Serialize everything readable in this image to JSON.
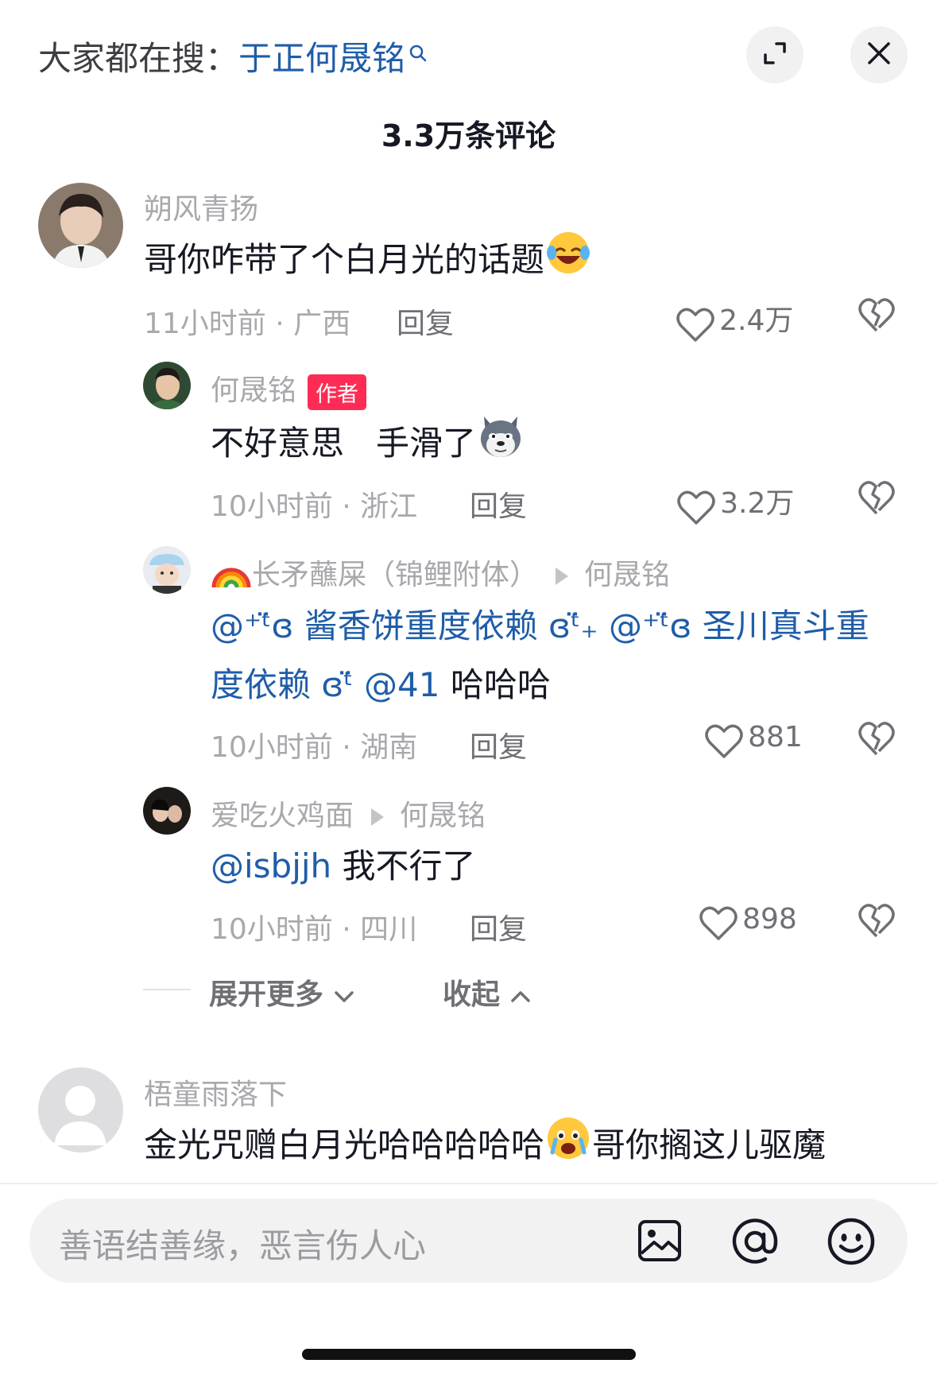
{
  "header": {
    "search_prefix": "大家都在搜：",
    "search_keyword": "于正何晟铭",
    "comment_count": "3.3万条评论"
  },
  "comments": [
    {
      "username": "朔风青扬",
      "text": "哥你咋带了个白月光的话题",
      "time_location": "11小时前 · 广西",
      "reply_label": "回复",
      "likes": "2.4万"
    },
    {
      "username": "梧童雨落下",
      "text": "金光咒赠白月光哈哈哈哈哈",
      "text_suffix": "哥你搁这儿驱魔"
    }
  ],
  "replies": [
    {
      "username": "何晟铭",
      "badge": "作者",
      "text": "不好意思   手滑了",
      "time_location": "10小时前 · 浙江",
      "reply_label": "回复",
      "likes": "3.2万"
    },
    {
      "username": "长矛蘸屎（锦鲤附体）",
      "reply_to": "何晟铭",
      "mention1": "@⁺ᵗ̈ɞ 酱香饼重度依赖 ɞᵗ̈₊",
      "mention2": "@⁺ᵗ̈ɞ 圣川真斗重",
      "mention2_cont": "度依赖 ɞᵗ̈",
      "mention3": "@41",
      "text_tail": "哈哈哈",
      "time_location": "10小时前 · 湖南",
      "reply_label": "回复",
      "likes": "881"
    },
    {
      "username": "爱吃火鸡面",
      "reply_to": "何晟铭",
      "mention": "@isbjjh",
      "text": "我不行了",
      "time_location": "10小时前 · 四川",
      "reply_label": "回复",
      "likes": "898"
    }
  ],
  "thread_controls": {
    "expand_more": "展开更多",
    "collapse": "收起"
  },
  "input": {
    "placeholder": "善语结善缘，恶言伤人心"
  },
  "icons": [
    "search-mini-icon",
    "expand-icon",
    "close-icon",
    "heart-icon",
    "broken-heart-icon",
    "image-icon",
    "at-icon",
    "emoji-icon",
    "chevron-down-icon",
    "chevron-up-icon"
  ],
  "colors": {
    "accent_red": "#fe2c55",
    "link_blue": "#1f5da8",
    "muted": "#a8a8ad"
  }
}
